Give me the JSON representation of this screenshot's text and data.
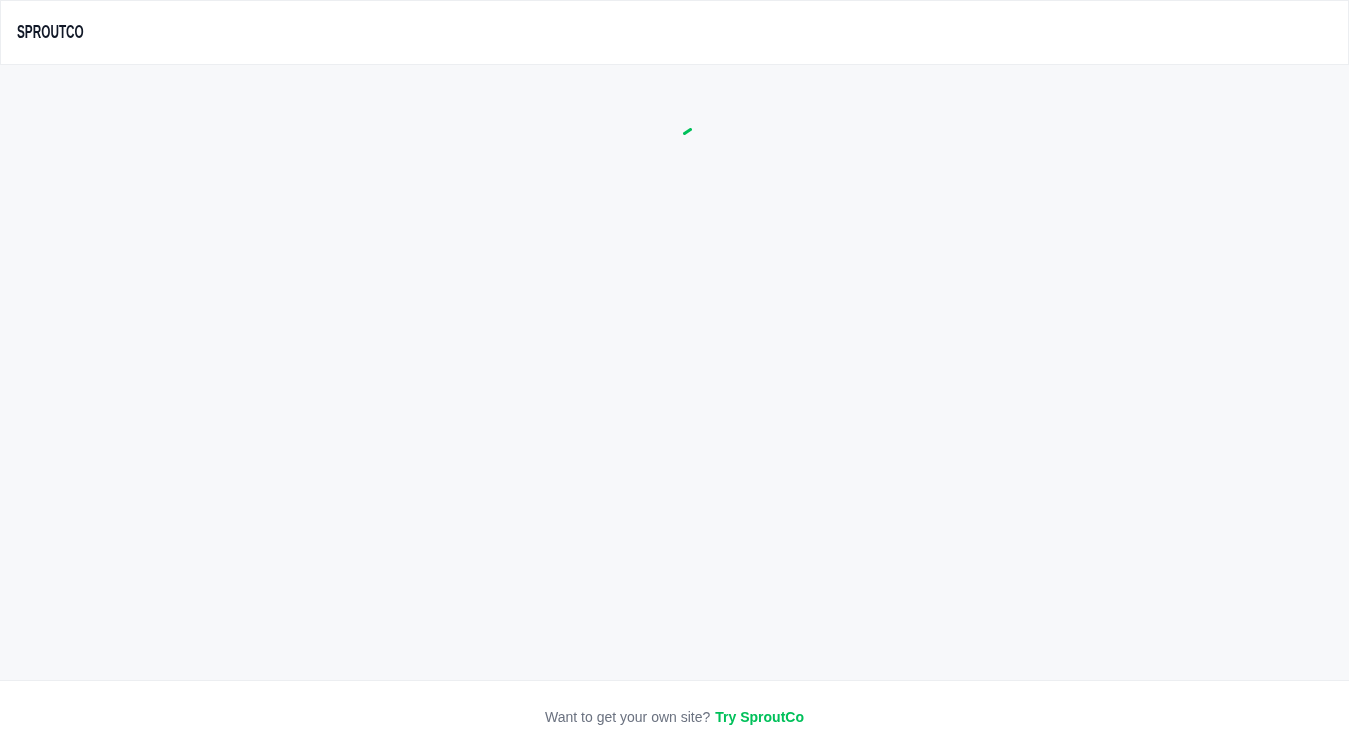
{
  "header": {
    "logo": "SPROUTCO"
  },
  "content": {
    "loading": true
  },
  "footer": {
    "prompt": "Want to get your own site?",
    "link": "Try SproutCo"
  }
}
